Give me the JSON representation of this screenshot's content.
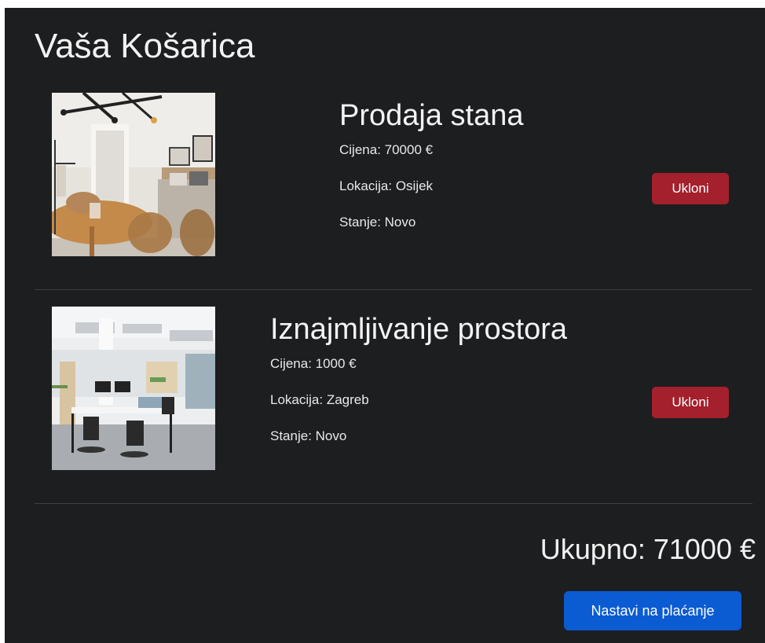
{
  "cart": {
    "title": "Vaša Košarica",
    "items": [
      {
        "name": "Prodaja stana",
        "price": "Cijena: 70000 €",
        "location": "Lokacija: Osijek",
        "condition": "Stanje: Novo",
        "remove_label": "Ukloni",
        "image_icon": "apartment-photo"
      },
      {
        "name": "Iznajmljivanje prostora",
        "price": "Cijena: 1000 €",
        "location": "Lokacija: Zagreb",
        "condition": "Stanje: Novo",
        "remove_label": "Ukloni",
        "image_icon": "office-photo"
      }
    ],
    "total": "Ukupno: 71000 €",
    "checkout_label": "Nastavi na plaćanje"
  },
  "colors": {
    "background": "#1d1e20",
    "danger": "#a3202c",
    "primary": "#0b5bd3"
  }
}
